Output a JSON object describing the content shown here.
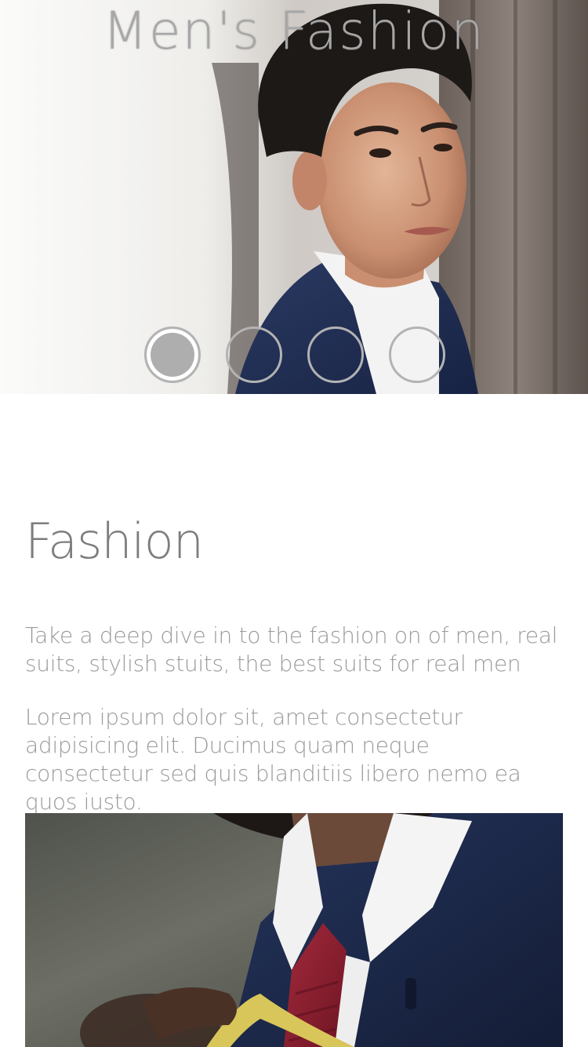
{
  "hero": {
    "title": "Men's Fashion",
    "slides": [
      {
        "active": true
      },
      {
        "active": false
      },
      {
        "active": false
      },
      {
        "active": false
      }
    ],
    "image_subject": "man-in-navy-suit-portrait"
  },
  "section": {
    "title": "Fashion",
    "paragraph_1": "Take a deep dive in to the fashion on of men, real suits, stylish stuits, the best suits for real men",
    "paragraph_2": "Lorem ipsum dolor sit, amet consectetur adipisicing elit. Ducimus quam neque consectetur sed quis blanditiis libero nemo ea quos iusto."
  },
  "photo": {
    "image_subject": "suit-being-measured-with-tape"
  },
  "colors": {
    "title_text": "#a7a7a7",
    "heading_text": "#7d7d7d",
    "body_text": "#9a9a9a",
    "suit_navy": "#1f2d4e",
    "tie_red": "#8c1f2f",
    "tape_yellow": "#d9c65a"
  }
}
